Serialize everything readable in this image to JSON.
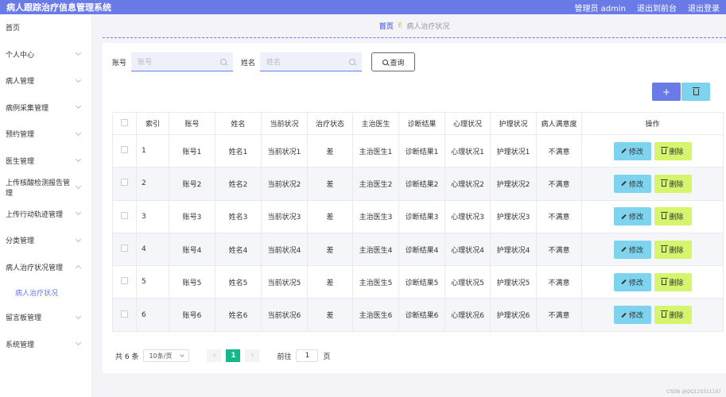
{
  "app": {
    "title": "病人跟踪治疗信息管理系统"
  },
  "topbar": {
    "user": "管理员 admin",
    "front": "退出到前台",
    "logout": "退出登录"
  },
  "sidebar": {
    "items": [
      {
        "label": "首页"
      },
      {
        "label": "个人中心"
      },
      {
        "label": "病人管理"
      },
      {
        "label": "病例采集管理"
      },
      {
        "label": "预约管理"
      },
      {
        "label": "医生管理"
      },
      {
        "label": "上传核酸检测报告管理"
      },
      {
        "label": "上传行动轨迹管理"
      },
      {
        "label": "分类管理"
      },
      {
        "label": "病人治疗状况管理"
      },
      {
        "label": "病人治疗状况"
      },
      {
        "label": "留言板管理"
      },
      {
        "label": "系统管理"
      }
    ]
  },
  "breadcrumb": {
    "home": "首页",
    "current": "病人治疗状况"
  },
  "search": {
    "account_label": "账号",
    "account_placeholder": "账号",
    "name_label": "姓名",
    "name_placeholder": "姓名",
    "query_label": "查询"
  },
  "toolbar": {
    "add_label": "+"
  },
  "table": {
    "headers": [
      "索引",
      "账号",
      "姓名",
      "当前状况",
      "治疗状态",
      "主治医生",
      "诊断结果",
      "心理状况",
      "护理状况",
      "病人满意度",
      "操作"
    ],
    "rows": [
      {
        "idx": "1",
        "account": "账号1",
        "name": "姓名1",
        "current": "当前状况1",
        "status": "差",
        "doctor": "主治医生1",
        "diagnosis": "诊断结果1",
        "mental": "心理状况1",
        "nursing": "护理状况1",
        "satisfaction": "不满意"
      },
      {
        "idx": "2",
        "account": "账号2",
        "name": "姓名2",
        "current": "当前状况2",
        "status": "差",
        "doctor": "主治医生2",
        "diagnosis": "诊断结果2",
        "mental": "心理状况2",
        "nursing": "护理状况2",
        "satisfaction": "不满意"
      },
      {
        "idx": "3",
        "account": "账号3",
        "name": "姓名3",
        "current": "当前状况3",
        "status": "差",
        "doctor": "主治医生3",
        "diagnosis": "诊断结果3",
        "mental": "心理状况3",
        "nursing": "护理状况3",
        "satisfaction": "不满意"
      },
      {
        "idx": "4",
        "account": "账号4",
        "name": "姓名4",
        "current": "当前状况4",
        "status": "差",
        "doctor": "主治医生4",
        "diagnosis": "诊断结果4",
        "mental": "心理状况4",
        "nursing": "护理状况4",
        "satisfaction": "不满意"
      },
      {
        "idx": "5",
        "account": "账号5",
        "name": "姓名5",
        "current": "当前状况5",
        "status": "差",
        "doctor": "主治医生5",
        "diagnosis": "诊断结果5",
        "mental": "心理状况5",
        "nursing": "护理状况5",
        "satisfaction": "不满意"
      },
      {
        "idx": "6",
        "account": "账号6",
        "name": "姓名6",
        "current": "当前状况6",
        "status": "差",
        "doctor": "主治医生6",
        "diagnosis": "诊断结果6",
        "mental": "心理状况6",
        "nursing": "护理状况6",
        "satisfaction": "不满意"
      }
    ],
    "edit_label": "修改",
    "delete_label": "删除"
  },
  "pagination": {
    "total": "共 6 条",
    "page_size": "10条/页",
    "prev": "‹",
    "current_page": "1",
    "next": "›",
    "goto_label": "前往",
    "goto_value": "1",
    "page_unit": "页"
  },
  "watermark": "CSDN @QQ123311197"
}
